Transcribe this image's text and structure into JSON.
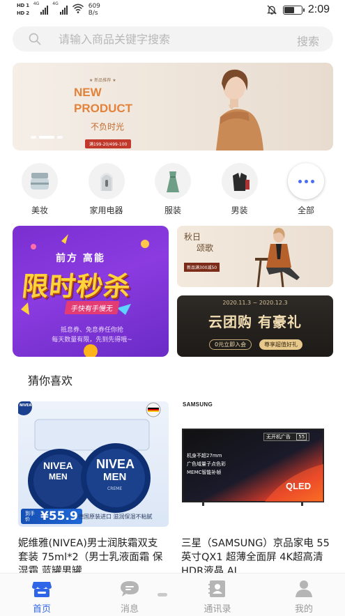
{
  "status_bar": {
    "sim1": "HD 1",
    "sim2": "HD 2",
    "net1": "4G",
    "net2": "4G",
    "speed_value": "609",
    "speed_unit": "B/s",
    "time": "2:09",
    "battery_level": 0.55
  },
  "search": {
    "placeholder": "请输入商品关键字搜索",
    "button": "搜索"
  },
  "banner": {
    "small": "★ 新品推荐 ★",
    "title_line1": "NEW",
    "title_line2": "PRODUCT",
    "subtitle": "不负时光",
    "price_tag": "满199-20/499-100",
    "dots": 3,
    "active_dot": 1
  },
  "categories": [
    {
      "label": "美妆",
      "icon": "cosmetics-jar-icon"
    },
    {
      "label": "家用电器",
      "icon": "appliance-icon"
    },
    {
      "label": "服装",
      "icon": "dress-icon"
    },
    {
      "label": "男装",
      "icon": "menswear-icon"
    },
    {
      "label": "全部",
      "icon": "more-dots-icon"
    }
  ],
  "promos": {
    "flash": {
      "top": "前方 高能",
      "title": "限时秒杀",
      "tag": "手快有手慢无",
      "foot_line1": "抵息券、免息券任你抢",
      "foot_line2": "每天数量有限，先到先得哦~"
    },
    "autumn": {
      "line1": "秋日",
      "line2": "颂歌",
      "badge": "新品满300减50"
    },
    "group_buy": {
      "date": "2020.11.3 ~ 2020.12.3",
      "title": "云团购 有豪礼",
      "btn1": "0元立即入会",
      "btn2": "尊享超值好礼"
    }
  },
  "section": {
    "title": "猜你喜欢"
  },
  "products": [
    {
      "name": "妮维雅(NIVEA)男士润肤霜双支套装 75ml*2（男士乳液面霜 保湿霜 蓝罐男罐",
      "price_label": "到手价",
      "price": "¥55.9",
      "desc": "德国原装进口 滋润保湿不粘腻",
      "brand": "NIVEA",
      "brand_sub": "MEN",
      "tin_text": "CREME"
    },
    {
      "name": "三星（SAMSUNG）京品家电 55英寸QX1 超薄全面屏 4K超高清HDR液晶 AI",
      "logo": "SAMSUNG",
      "tv_lines": [
        "机身不超27mm",
        "广色域量子点色彩",
        "MEMC智能补帧"
      ],
      "tv_tag": "无开机广告",
      "tv_size": "55",
      "tv_brand": "QLED"
    }
  ],
  "nav": [
    {
      "label": "首页",
      "active": true
    },
    {
      "label": "消息",
      "active": false
    },
    {
      "label": "通讯录",
      "active": false
    },
    {
      "label": "我的",
      "active": false
    }
  ],
  "colors": {
    "accent": "#2f66e8",
    "flash_bg": "#7a2fd1",
    "price_blue": "#1550b4"
  }
}
